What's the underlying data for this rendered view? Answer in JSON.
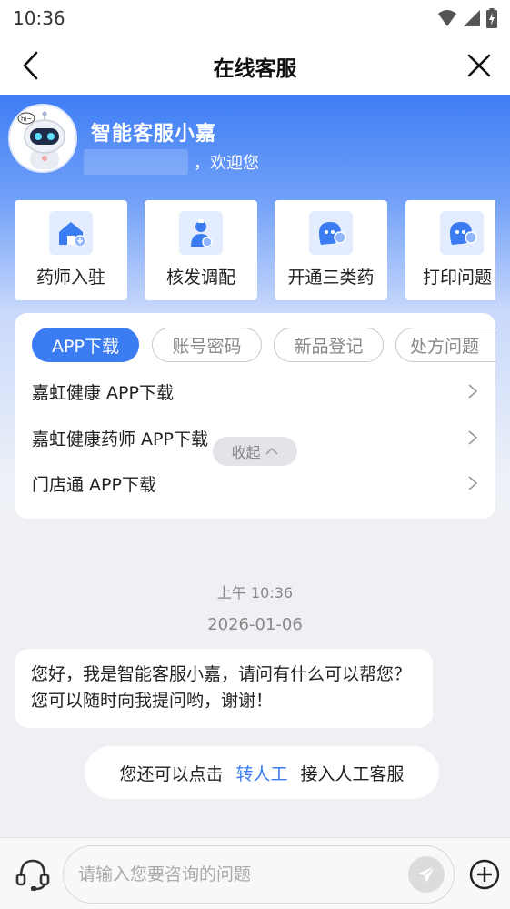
{
  "status_bar": {
    "time": "10:36"
  },
  "nav": {
    "title": "在线客服"
  },
  "hero": {
    "bot_name": "智能客服小嘉",
    "welcome": "，欢迎您"
  },
  "quick_actions": [
    {
      "label": "药师入驻",
      "icon": "house-plus-icon"
    },
    {
      "label": "核发调配",
      "icon": "pharmacist-icon"
    },
    {
      "label": "开通三类药",
      "icon": "chat-bot-icon"
    },
    {
      "label": "打印问题",
      "icon": "chat-bot-icon"
    }
  ],
  "faq": {
    "tabs": [
      {
        "label": "APP下载",
        "active": true
      },
      {
        "label": "账号密码",
        "active": false
      },
      {
        "label": "新品登记",
        "active": false
      },
      {
        "label": "处方问题",
        "active": false
      }
    ],
    "items": [
      {
        "label": "嘉虹健康 APP下载"
      },
      {
        "label": "嘉虹健康药师 APP下载"
      },
      {
        "label": "门店通 APP下载"
      }
    ]
  },
  "collapse": {
    "label": "收起"
  },
  "chat": {
    "time": "上午 10:36",
    "date": "2026-01-06",
    "bot_message": "您好，我是智能客服小嘉，请问有什么可以帮您？您可以随时向我提问哟，谢谢！",
    "handoff_prefix": "您还可以点击",
    "handoff_link": "转人工",
    "handoff_suffix": "接入人工客服"
  },
  "input": {
    "placeholder": "请输入您要咨询的问题",
    "value": ""
  },
  "colors": {
    "accent": "#3b7cf2",
    "hero_top": "#3f7ef6",
    "background": "#eef0f4"
  }
}
